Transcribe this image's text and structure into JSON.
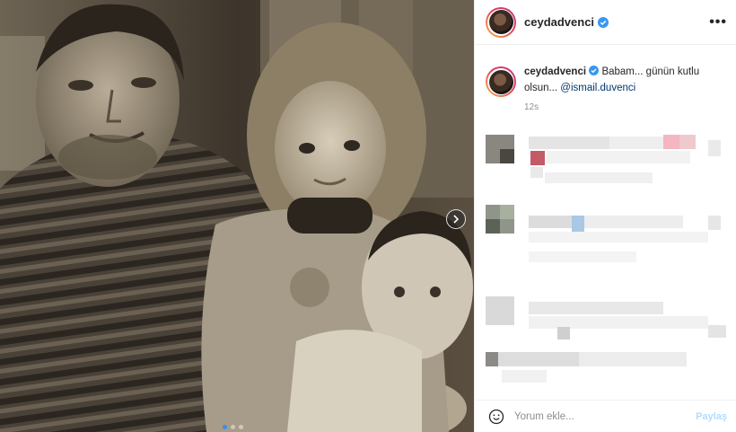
{
  "post": {
    "username": "ceydadvenci",
    "verified": true,
    "more_label": "•••"
  },
  "caption": {
    "username": "ceydadvenci",
    "text": "Babam... günün kutlu olsun...",
    "mention": "@ismail.duvenci",
    "time": "12s"
  },
  "comment_box": {
    "placeholder": "Yorum ekle...",
    "submit_label": "Paylaş"
  },
  "carousel": {
    "count": 3,
    "active_index": 0
  },
  "colors": {
    "link": "#00376b",
    "muted": "#8e8e8e",
    "share_disabled": "#b3dbff",
    "verified": "#3897f0"
  }
}
